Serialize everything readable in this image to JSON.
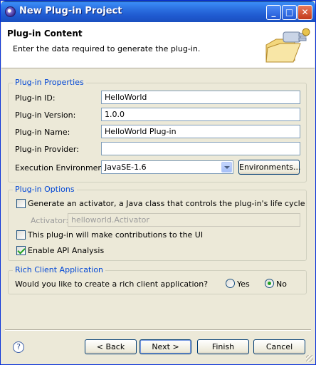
{
  "window": {
    "title": "New Plug-in Project"
  },
  "header": {
    "title": "Plug-in Content",
    "description": "Enter the data required to generate the plug-in."
  },
  "plugin_properties": {
    "legend": "Plug-in Properties",
    "id_label": "Plug-in ID:",
    "id_value": "HelloWorld",
    "version_label": "Plug-in Version:",
    "version_value": "1.0.0",
    "name_label": "Plug-in Name:",
    "name_value": "HelloWorld Plug-in",
    "provider_label": "Plug-in Provider:",
    "provider_value": "",
    "env_label": "Execution Environment:",
    "env_value": "JavaSE-1.6",
    "env_button": "Environments..."
  },
  "plugin_options": {
    "legend": "Plug-in Options",
    "generate_activator_label": "Generate an activator, a Java class that controls the plug-in's life cycle",
    "generate_activator_checked": false,
    "activator_label": "Activator:",
    "activator_value": "helloworld.Activator",
    "ui_contrib_label": "This plug-in will make contributions to the UI",
    "ui_contrib_checked": false,
    "api_analysis_label": "Enable API Analysis",
    "api_analysis_checked": true
  },
  "rcp": {
    "legend": "Rich Client Application",
    "question": "Would you like to create a rich client application?",
    "yes_label": "Yes",
    "no_label": "No",
    "selected": "No"
  },
  "footer": {
    "help": "?",
    "back": "< Back",
    "next": "Next >",
    "finish": "Finish",
    "cancel": "Cancel"
  },
  "colors": {
    "accent": "#0046d5",
    "titlebar": "#2b6fe0",
    "dialog_bg": "#ece9d8"
  },
  "icons": [
    "eclipse-logo-icon",
    "minimize-icon",
    "maximize-icon",
    "close-icon",
    "plugin-banner-icon",
    "help-icon",
    "combo-arrow-icon",
    "resize-grip-icon"
  ]
}
